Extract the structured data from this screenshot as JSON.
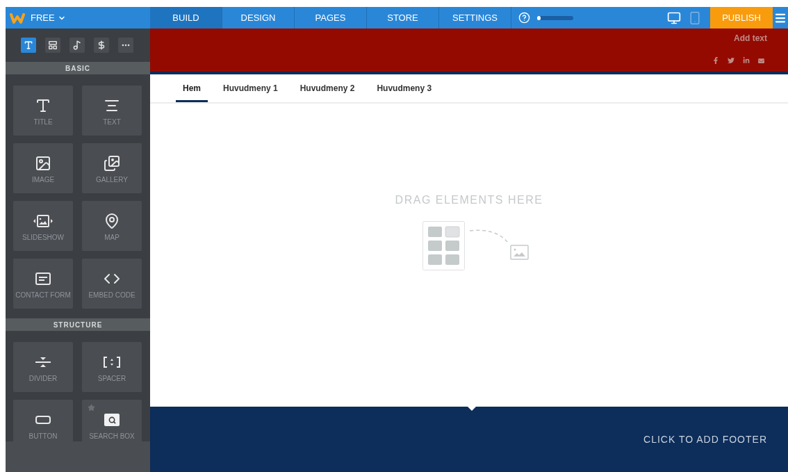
{
  "topbar": {
    "plan": "FREE",
    "tabs": [
      {
        "label": "BUILD",
        "selected": true
      },
      {
        "label": "DESIGN",
        "selected": false
      },
      {
        "label": "PAGES",
        "selected": false
      },
      {
        "label": "STORE",
        "selected": false
      },
      {
        "label": "SETTINGS",
        "selected": false
      }
    ],
    "progress": {
      "level": 0.05
    },
    "devices": [
      {
        "kind": "desktop",
        "selected": true
      },
      {
        "kind": "mobile",
        "selected": false
      }
    ],
    "publish": "PUBLISH"
  },
  "sidebar": {
    "tool_tabs": [
      {
        "kind": "text",
        "selected": true
      },
      {
        "kind": "layout",
        "selected": false
      },
      {
        "kind": "music",
        "selected": false
      },
      {
        "kind": "store",
        "selected": false
      },
      {
        "kind": "more",
        "selected": false
      }
    ],
    "sections": [
      {
        "title": "BASIC",
        "tiles": [
          {
            "kind": "title",
            "label": "TITLE",
            "starred": false
          },
          {
            "kind": "text",
            "label": "TEXT",
            "starred": false
          },
          {
            "kind": "image",
            "label": "IMAGE",
            "starred": false
          },
          {
            "kind": "gallery",
            "label": "GALLERY",
            "starred": false
          },
          {
            "kind": "slideshow",
            "label": "SLIDESHOW",
            "starred": false
          },
          {
            "kind": "map",
            "label": "MAP",
            "starred": false
          },
          {
            "kind": "form",
            "label": "CONTACT FORM",
            "starred": false
          },
          {
            "kind": "code",
            "label": "EMBED CODE",
            "starred": false
          }
        ]
      },
      {
        "title": "STRUCTURE",
        "tiles": [
          {
            "kind": "divider",
            "label": "DIVIDER",
            "starred": false
          },
          {
            "kind": "spacer",
            "label": "SPACER",
            "starred": false
          },
          {
            "kind": "button",
            "label": "BUTTON",
            "starred": false
          },
          {
            "kind": "search",
            "label": "SEARCH BOX",
            "starred": true
          }
        ]
      }
    ]
  },
  "site": {
    "header": {
      "text": "Add text",
      "social": [
        {
          "kind": "facebook"
        },
        {
          "kind": "twitter"
        },
        {
          "kind": "linkedin"
        },
        {
          "kind": "mail"
        }
      ]
    },
    "nav": [
      {
        "label": "Hem",
        "selected": true
      },
      {
        "label": "Huvudmeny 1",
        "selected": false
      },
      {
        "label": "Huvudmeny 2",
        "selected": false
      },
      {
        "label": "Huvudmeny 3",
        "selected": false
      }
    ],
    "drop_hint": "DRAG ELEMENTS HERE",
    "footer": "CLICK TO ADD FOOTER"
  }
}
